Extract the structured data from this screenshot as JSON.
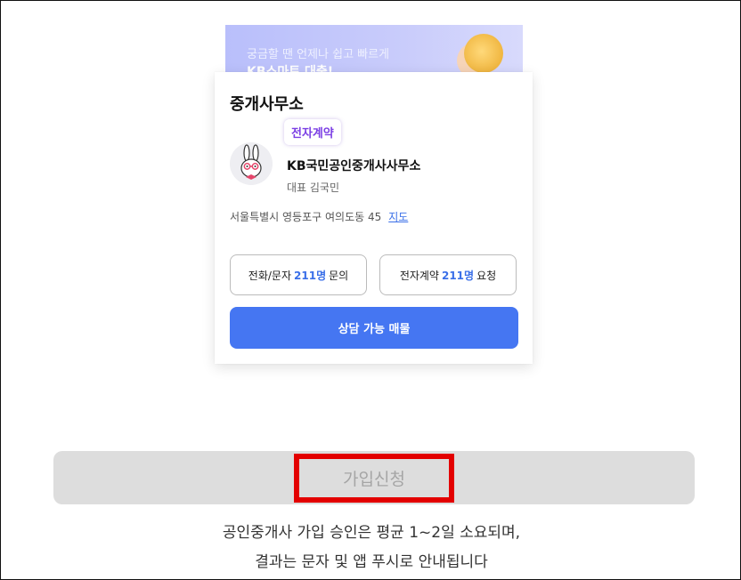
{
  "banner": {
    "line1": "궁금할 땐 언제나 쉽고 빠르게",
    "line2": "KB스마트 대출!"
  },
  "card": {
    "title": "중개사무소",
    "badge": "전자계약",
    "office_name": "KB국민공인중개사사무소",
    "ceo": "대표 김국민",
    "address": "서울특별시 영등포구 여의도동 45",
    "map_link": "지도",
    "call_button": {
      "prefix": "전화/문자",
      "count": "211명",
      "suffix": "문의"
    },
    "contract_button": {
      "prefix": "전자계약",
      "count": "211명",
      "suffix": "요청"
    },
    "primary_button": "상담 가능 매물"
  },
  "signup": {
    "label": "가입신청",
    "notice_line1": "공인중개사 가입 승인은 평균 1~2일 소요되며,",
    "notice_line2": "결과는 문자 및 앱 푸시로 안내됩니다"
  },
  "colors": {
    "accent": "#4576f2",
    "badge_text": "#7b3fe4",
    "highlight_border": "#e30000",
    "signup_bg": "#dddddd"
  }
}
